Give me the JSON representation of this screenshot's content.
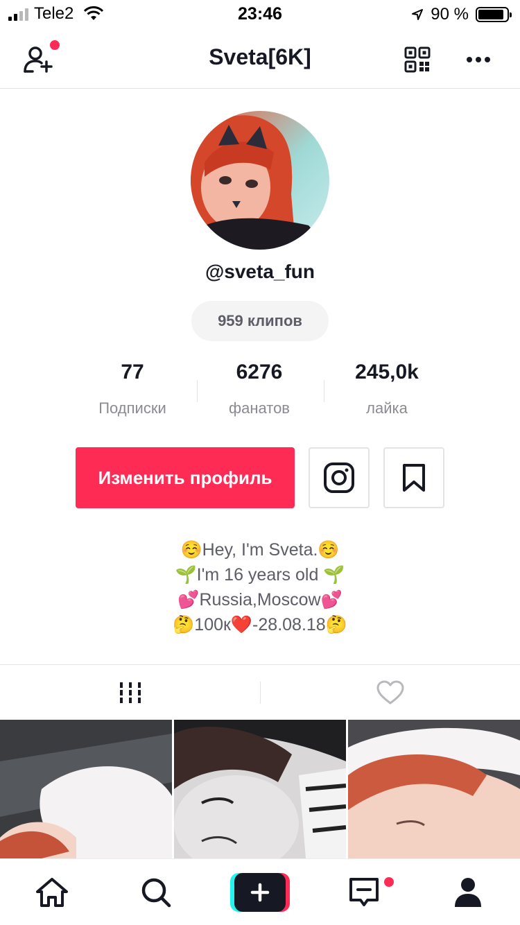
{
  "status_bar": {
    "carrier": "Tele2",
    "time": "23:46",
    "battery": "90 %",
    "battery_level": 0.9
  },
  "header": {
    "title": "Sveta[6K]",
    "icons": [
      "add-user-icon",
      "qr-code-icon",
      "more-icon"
    ]
  },
  "profile": {
    "username": "@sveta_fun",
    "clips": "959 клипов",
    "stats": [
      {
        "value": "77",
        "label": "Подписки"
      },
      {
        "value": "6276",
        "label": "фанатов"
      },
      {
        "value": "245,0k",
        "label": "лайка"
      }
    ],
    "edit_button": "Изменить профиль",
    "bio": [
      "☺️Hey, I'm Sveta.☺️",
      "🌱I'm 16 years old 🌱",
      "💕Russia,Moscow💕",
      "🤔100к❤️-28.08.18🤔"
    ]
  },
  "tabs": [
    "videos-grid-icon",
    "liked-heart-icon"
  ],
  "bottom_nav": [
    "home-icon",
    "search-icon",
    "create-plus-icon",
    "inbox-icon",
    "profile-icon"
  ],
  "colors": {
    "accent": "#fe2c55",
    "cyan": "#25f4ee",
    "text": "#161823",
    "secondary": "#8a8b91",
    "divider": "#e3e3e4"
  }
}
